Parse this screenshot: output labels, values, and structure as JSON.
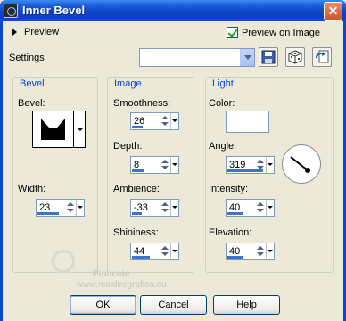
{
  "window": {
    "title": "Inner Bevel",
    "close_label": "✕"
  },
  "preview": {
    "toggle_label": "Preview",
    "checkbox_label": "Preview on Image",
    "checked": true
  },
  "settings": {
    "label": "Settings",
    "value": ""
  },
  "bevel_group": {
    "title": "Bevel",
    "bevel_label": "Bevel:",
    "width_label": "Width:",
    "width_value": "23"
  },
  "image_group": {
    "title": "Image",
    "smoothness_label": "Smoothness:",
    "smoothness_value": "26",
    "depth_label": "Depth:",
    "depth_value": "8",
    "ambience_label": "Ambience:",
    "ambience_value": "-33",
    "shininess_label": "Shininess:",
    "shininess_value": "44"
  },
  "light_group": {
    "title": "Light",
    "color_label": "Color:",
    "color_value": "#ffffff",
    "angle_label": "Angle:",
    "angle_value": "319",
    "intensity_label": "Intensity:",
    "intensity_value": "40",
    "elevation_label": "Elevation:",
    "elevation_value": "40"
  },
  "buttons": {
    "ok": "OK",
    "cancel": "Cancel",
    "help": "Help"
  },
  "watermark": {
    "line1": "Pinuccia",
    "line2": "www.maidiregrafica.eu"
  },
  "icons": {
    "title": "app-icon",
    "close": "close-icon",
    "save": "save-preset-icon",
    "random": "randomize-icon",
    "reset": "reset-icon",
    "angle": "angle-dial-icon"
  },
  "colors": {
    "titlebar": "#0a47c9",
    "group_title": "#0046d5",
    "spin_bar": "#3c74c9"
  }
}
